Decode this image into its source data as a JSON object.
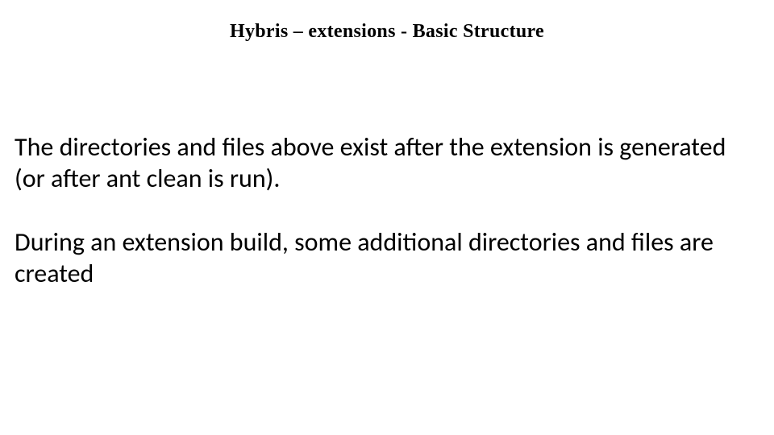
{
  "slide": {
    "title": "Hybris – extensions -  Basic Structure",
    "paragraphs": [
      "The directories and files above exist after the extension is generated (or after ant clean is run).",
      "During an extension build, some additional directories and files are created"
    ]
  }
}
